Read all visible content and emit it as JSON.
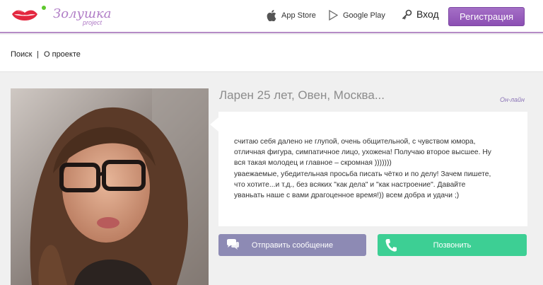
{
  "header": {
    "logo_text": "Золушка",
    "logo_sub": "project",
    "app_store": "App Store",
    "google_play": "Google Play",
    "login": "Вход",
    "register": "Регистрация"
  },
  "breadcrumb": {
    "items": [
      "Поиск",
      "О проекте"
    ],
    "separator": "|"
  },
  "profile": {
    "title": "Ларен 25 лет, Овен,  Москва...",
    "status": "Он-лайн",
    "about": [
      "считаю себя далено не глупой, очень общительной, с чувством юмора,",
      "отличная фигура, симпатичное лицо, ухожена! Получаю второе высшее. Ну",
      "вся такая молодец и главное – скромная )))))))",
      "уваежаемые, убедительная просьба писать чётко и по делу! Зачем пишете,",
      "что хотите...и т.д., без всяких \"как дела\" и \"как настроение\". Давайте",
      "уваньать наше с вами драгоценное время!)) всем добра и удачи ;)"
    ]
  },
  "actions": {
    "message": "Отправить сообщение",
    "call": "Позвонить"
  },
  "colors": {
    "accent": "#9a63bf",
    "message_button": "#8d8ab4",
    "call_button": "#3dcf94"
  }
}
